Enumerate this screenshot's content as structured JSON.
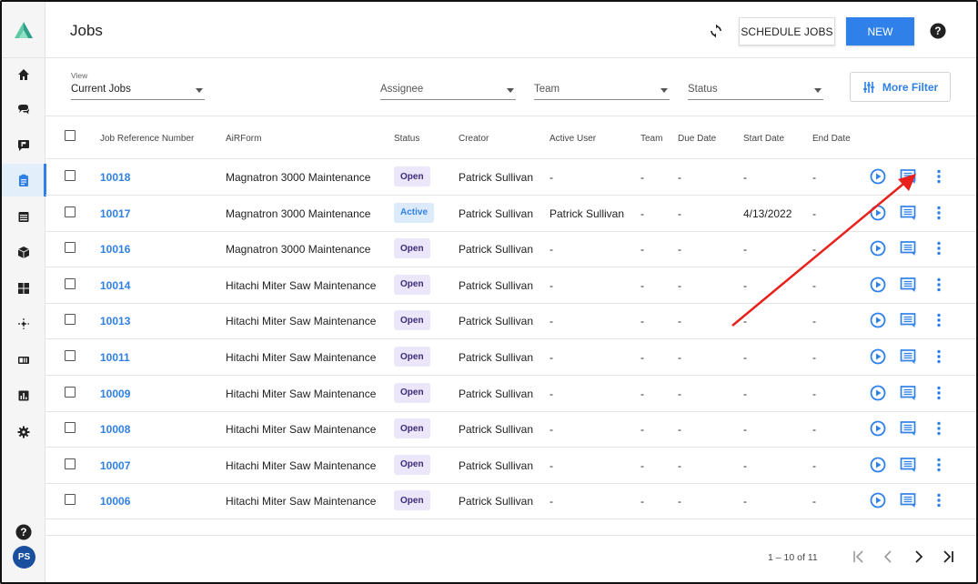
{
  "app": {
    "page_title": "Jobs",
    "avatar_initials": "PS",
    "accent_color": "#2f80e8"
  },
  "sidebar": {
    "items": [
      {
        "name": "home-icon"
      },
      {
        "name": "chat-icon"
      },
      {
        "name": "message-flag-icon"
      },
      {
        "name": "clipboard-icon",
        "active": true
      },
      {
        "name": "calendar-icon"
      },
      {
        "name": "box-icon"
      },
      {
        "name": "dashboard-icon"
      },
      {
        "name": "move-icon"
      },
      {
        "name": "badge-icon"
      },
      {
        "name": "chart-icon"
      },
      {
        "name": "gear-icon"
      }
    ]
  },
  "header": {
    "schedule_label": "SCHEDULE JOBS",
    "new_label": "NEW"
  },
  "filters": {
    "view_label": "View",
    "view_value": "Current Jobs",
    "assignee_placeholder": "Assignee",
    "team_placeholder": "Team",
    "status_placeholder": "Status",
    "more_filter_label": "More Filter"
  },
  "table": {
    "columns": [
      "Job Reference Number",
      "AiRForm",
      "Status",
      "Creator",
      "Active User",
      "Team",
      "Due Date",
      "Start Date",
      "End Date"
    ],
    "rows": [
      {
        "ref": "10018",
        "form": "Magnatron 3000 Maintenance",
        "status": "Open",
        "creator": "Patrick Sullivan",
        "active_user": "-",
        "team": "-",
        "due": "-",
        "start": "-",
        "end": "-"
      },
      {
        "ref": "10017",
        "form": "Magnatron 3000 Maintenance",
        "status": "Active",
        "creator": "Patrick Sullivan",
        "active_user": "Patrick Sullivan",
        "team": "-",
        "due": "-",
        "start": "4/13/2022",
        "end": "-"
      },
      {
        "ref": "10016",
        "form": "Magnatron 3000 Maintenance",
        "status": "Open",
        "creator": "Patrick Sullivan",
        "active_user": "-",
        "team": "-",
        "due": "-",
        "start": "-",
        "end": "-"
      },
      {
        "ref": "10014",
        "form": "Hitachi Miter Saw Maintenance",
        "status": "Open",
        "creator": "Patrick Sullivan",
        "active_user": "-",
        "team": "-",
        "due": "-",
        "start": "-",
        "end": "-"
      },
      {
        "ref": "10013",
        "form": "Hitachi Miter Saw Maintenance",
        "status": "Open",
        "creator": "Patrick Sullivan",
        "active_user": "-",
        "team": "-",
        "due": "-",
        "start": "-",
        "end": "-"
      },
      {
        "ref": "10011",
        "form": "Hitachi Miter Saw Maintenance",
        "status": "Open",
        "creator": "Patrick Sullivan",
        "active_user": "-",
        "team": "-",
        "due": "-",
        "start": "-",
        "end": "-"
      },
      {
        "ref": "10009",
        "form": "Hitachi Miter Saw Maintenance",
        "status": "Open",
        "creator": "Patrick Sullivan",
        "active_user": "-",
        "team": "-",
        "due": "-",
        "start": "-",
        "end": "-"
      },
      {
        "ref": "10008",
        "form": "Hitachi Miter Saw Maintenance",
        "status": "Open",
        "creator": "Patrick Sullivan",
        "active_user": "-",
        "team": "-",
        "due": "-",
        "start": "-",
        "end": "-"
      },
      {
        "ref": "10007",
        "form": "Hitachi Miter Saw Maintenance",
        "status": "Open",
        "creator": "Patrick Sullivan",
        "active_user": "-",
        "team": "-",
        "due": "-",
        "start": "-",
        "end": "-"
      },
      {
        "ref": "10006",
        "form": "Hitachi Miter Saw Maintenance",
        "status": "Open",
        "creator": "Patrick Sullivan",
        "active_user": "-",
        "team": "-",
        "due": "-",
        "start": "-",
        "end": "-"
      }
    ]
  },
  "pagination": {
    "range_text": "1 – 10 of 11"
  },
  "annotation": {
    "arrow_color": "#e8211c"
  }
}
